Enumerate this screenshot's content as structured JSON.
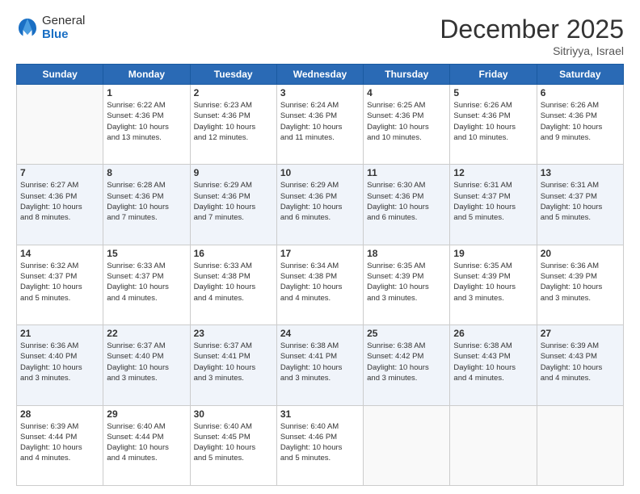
{
  "logo": {
    "general": "General",
    "blue": "Blue"
  },
  "header": {
    "month": "December 2025",
    "location": "Sitriyya, Israel"
  },
  "days_of_week": [
    "Sunday",
    "Monday",
    "Tuesday",
    "Wednesday",
    "Thursday",
    "Friday",
    "Saturday"
  ],
  "weeks": [
    [
      {
        "day": "",
        "info": ""
      },
      {
        "day": "1",
        "info": "Sunrise: 6:22 AM\nSunset: 4:36 PM\nDaylight: 10 hours\nand 13 minutes."
      },
      {
        "day": "2",
        "info": "Sunrise: 6:23 AM\nSunset: 4:36 PM\nDaylight: 10 hours\nand 12 minutes."
      },
      {
        "day": "3",
        "info": "Sunrise: 6:24 AM\nSunset: 4:36 PM\nDaylight: 10 hours\nand 11 minutes."
      },
      {
        "day": "4",
        "info": "Sunrise: 6:25 AM\nSunset: 4:36 PM\nDaylight: 10 hours\nand 10 minutes."
      },
      {
        "day": "5",
        "info": "Sunrise: 6:26 AM\nSunset: 4:36 PM\nDaylight: 10 hours\nand 10 minutes."
      },
      {
        "day": "6",
        "info": "Sunrise: 6:26 AM\nSunset: 4:36 PM\nDaylight: 10 hours\nand 9 minutes."
      }
    ],
    [
      {
        "day": "7",
        "info": "Sunrise: 6:27 AM\nSunset: 4:36 PM\nDaylight: 10 hours\nand 8 minutes."
      },
      {
        "day": "8",
        "info": "Sunrise: 6:28 AM\nSunset: 4:36 PM\nDaylight: 10 hours\nand 7 minutes."
      },
      {
        "day": "9",
        "info": "Sunrise: 6:29 AM\nSunset: 4:36 PM\nDaylight: 10 hours\nand 7 minutes."
      },
      {
        "day": "10",
        "info": "Sunrise: 6:29 AM\nSunset: 4:36 PM\nDaylight: 10 hours\nand 6 minutes."
      },
      {
        "day": "11",
        "info": "Sunrise: 6:30 AM\nSunset: 4:36 PM\nDaylight: 10 hours\nand 6 minutes."
      },
      {
        "day": "12",
        "info": "Sunrise: 6:31 AM\nSunset: 4:37 PM\nDaylight: 10 hours\nand 5 minutes."
      },
      {
        "day": "13",
        "info": "Sunrise: 6:31 AM\nSunset: 4:37 PM\nDaylight: 10 hours\nand 5 minutes."
      }
    ],
    [
      {
        "day": "14",
        "info": "Sunrise: 6:32 AM\nSunset: 4:37 PM\nDaylight: 10 hours\nand 5 minutes."
      },
      {
        "day": "15",
        "info": "Sunrise: 6:33 AM\nSunset: 4:37 PM\nDaylight: 10 hours\nand 4 minutes."
      },
      {
        "day": "16",
        "info": "Sunrise: 6:33 AM\nSunset: 4:38 PM\nDaylight: 10 hours\nand 4 minutes."
      },
      {
        "day": "17",
        "info": "Sunrise: 6:34 AM\nSunset: 4:38 PM\nDaylight: 10 hours\nand 4 minutes."
      },
      {
        "day": "18",
        "info": "Sunrise: 6:35 AM\nSunset: 4:39 PM\nDaylight: 10 hours\nand 3 minutes."
      },
      {
        "day": "19",
        "info": "Sunrise: 6:35 AM\nSunset: 4:39 PM\nDaylight: 10 hours\nand 3 minutes."
      },
      {
        "day": "20",
        "info": "Sunrise: 6:36 AM\nSunset: 4:39 PM\nDaylight: 10 hours\nand 3 minutes."
      }
    ],
    [
      {
        "day": "21",
        "info": "Sunrise: 6:36 AM\nSunset: 4:40 PM\nDaylight: 10 hours\nand 3 minutes."
      },
      {
        "day": "22",
        "info": "Sunrise: 6:37 AM\nSunset: 4:40 PM\nDaylight: 10 hours\nand 3 minutes."
      },
      {
        "day": "23",
        "info": "Sunrise: 6:37 AM\nSunset: 4:41 PM\nDaylight: 10 hours\nand 3 minutes."
      },
      {
        "day": "24",
        "info": "Sunrise: 6:38 AM\nSunset: 4:41 PM\nDaylight: 10 hours\nand 3 minutes."
      },
      {
        "day": "25",
        "info": "Sunrise: 6:38 AM\nSunset: 4:42 PM\nDaylight: 10 hours\nand 3 minutes."
      },
      {
        "day": "26",
        "info": "Sunrise: 6:38 AM\nSunset: 4:43 PM\nDaylight: 10 hours\nand 4 minutes."
      },
      {
        "day": "27",
        "info": "Sunrise: 6:39 AM\nSunset: 4:43 PM\nDaylight: 10 hours\nand 4 minutes."
      }
    ],
    [
      {
        "day": "28",
        "info": "Sunrise: 6:39 AM\nSunset: 4:44 PM\nDaylight: 10 hours\nand 4 minutes."
      },
      {
        "day": "29",
        "info": "Sunrise: 6:40 AM\nSunset: 4:44 PM\nDaylight: 10 hours\nand 4 minutes."
      },
      {
        "day": "30",
        "info": "Sunrise: 6:40 AM\nSunset: 4:45 PM\nDaylight: 10 hours\nand 5 minutes."
      },
      {
        "day": "31",
        "info": "Sunrise: 6:40 AM\nSunset: 4:46 PM\nDaylight: 10 hours\nand 5 minutes."
      },
      {
        "day": "",
        "info": ""
      },
      {
        "day": "",
        "info": ""
      },
      {
        "day": "",
        "info": ""
      }
    ]
  ]
}
